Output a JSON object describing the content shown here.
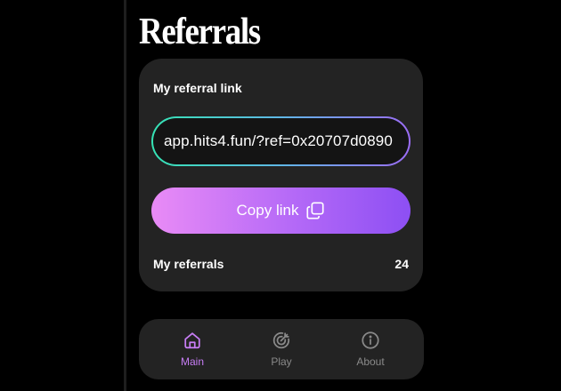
{
  "page": {
    "title": "Referrals"
  },
  "referral_card": {
    "title": "My referral link",
    "link_value": "app.hits4.fun/?ref=0x20707d0890",
    "copy_button_label": "Copy link",
    "referrals_label": "My referrals",
    "referrals_count": "24"
  },
  "nav": {
    "items": [
      {
        "label": "Main",
        "icon": "home-icon",
        "active": true
      },
      {
        "label": "Play",
        "icon": "target-icon",
        "active": false
      },
      {
        "label": "About",
        "icon": "info-icon",
        "active": false
      }
    ]
  },
  "colors": {
    "background": "#000000",
    "card": "#232323",
    "accent": "#c77df5",
    "inactive": "#8a8a8a"
  }
}
